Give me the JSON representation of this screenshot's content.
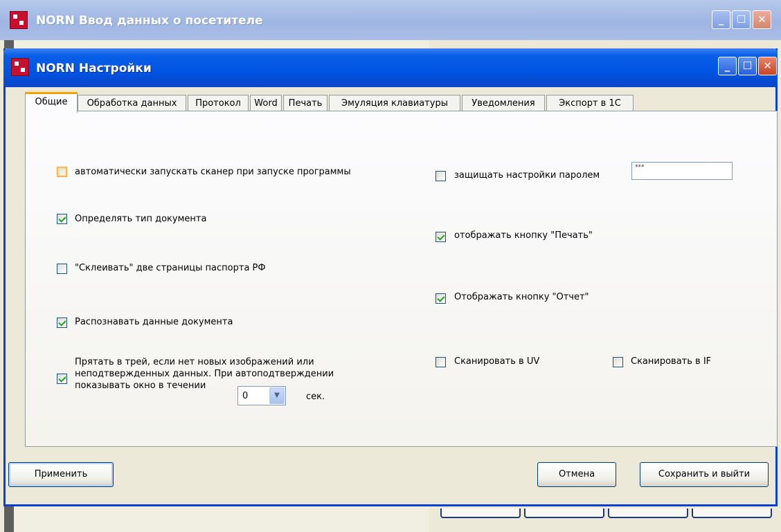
{
  "background_window": {
    "title": "NORN Ввод данных о посетителе"
  },
  "dialog": {
    "title": "NORN Настройки",
    "tabs": [
      {
        "label": "Общие",
        "active": true
      },
      {
        "label": "Обработка данных",
        "active": false
      },
      {
        "label": "Протокол",
        "active": false
      },
      {
        "label": "Word",
        "active": false
      },
      {
        "label": "Печать",
        "active": false
      },
      {
        "label": "Эмуляция клавиатуры",
        "active": false
      },
      {
        "label": "Уведомления",
        "active": false
      },
      {
        "label": "Экспорт в 1С",
        "active": false
      }
    ],
    "general": {
      "autostart_scanner": {
        "label": "автоматически запускать сканер при запуске программы",
        "checked": false
      },
      "detect_doc_type": {
        "label": "Определять тип документа",
        "checked": true
      },
      "glue_pages": {
        "label": "\"Склеивать\" две страницы паспорта РФ",
        "checked": false
      },
      "recognize_data": {
        "label": "Распознавать данные документа",
        "checked": true
      },
      "hide_to_tray": {
        "label": "Прятать в трей, если нет новых изображений или неподтвержденных данных. При автоподтверждении показывать окно в течении",
        "checked": true
      },
      "tray_seconds": {
        "value": "0",
        "unit": "сек."
      },
      "password_protect": {
        "label": "защищать настройки паролем",
        "checked": false,
        "password_value": "***"
      },
      "show_print_button": {
        "label": "отображать кнопку \"Печать\"",
        "checked": true
      },
      "show_report_button": {
        "label": "Отображать кнопку \"Отчет\"",
        "checked": true
      },
      "scan_uv": {
        "label": "Сканировать в UV",
        "checked": false
      },
      "scan_if": {
        "label": "Сканировать в IF",
        "checked": false
      }
    },
    "buttons": {
      "apply": "Применить",
      "cancel": "Отмена",
      "save_exit": "Сохранить и выйти"
    }
  },
  "icons": {
    "app": "norn-app-icon",
    "minimize": "minimize-icon",
    "maximize": "maximize-icon",
    "close": "close-icon",
    "dropdown": "chevron-down-icon"
  }
}
